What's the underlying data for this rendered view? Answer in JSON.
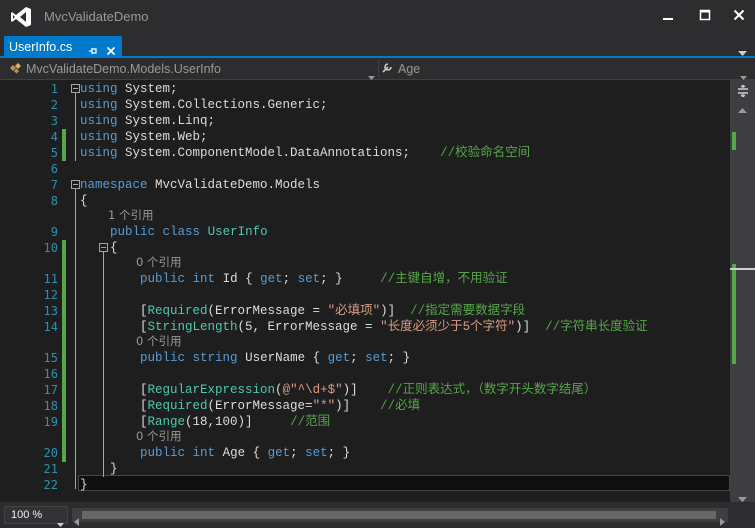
{
  "window": {
    "title": "MvcValidateDemo"
  },
  "tab": {
    "label": "UserInfo.cs"
  },
  "navbar": {
    "type_selector": "MvcValidateDemo.Models.UserInfo",
    "member_selector": "Age"
  },
  "editor": {
    "lines": [
      {
        "num": "1",
        "tokens": [
          [
            "kw",
            "using"
          ],
          [
            "",
            " System;"
          ]
        ]
      },
      {
        "num": "2",
        "tokens": [
          [
            "kw",
            "using"
          ],
          [
            "",
            " System.Collections.Generic;"
          ]
        ]
      },
      {
        "num": "3",
        "tokens": [
          [
            "kw",
            "using"
          ],
          [
            "",
            " System.Linq;"
          ]
        ]
      },
      {
        "num": "4",
        "tokens": [
          [
            "kw",
            "using"
          ],
          [
            "",
            " System.Web;"
          ]
        ]
      },
      {
        "num": "5",
        "tokens": [
          [
            "kw",
            "using"
          ],
          [
            "",
            " System.ComponentModel.DataAnnotations;    "
          ],
          [
            "cm",
            "//校验命名空间"
          ]
        ]
      },
      {
        "num": "6",
        "tokens": []
      },
      {
        "num": "7",
        "tokens": [
          [
            "kw",
            "namespace"
          ],
          [
            "",
            " MvcValidateDemo.Models"
          ]
        ]
      },
      {
        "num": "8",
        "tokens": [
          [
            "",
            "{"
          ]
        ]
      },
      {
        "num": "9",
        "tokens": [
          [
            "",
            "    "
          ],
          [
            "kw",
            "public"
          ],
          [
            "",
            " "
          ],
          [
            "kw",
            "class"
          ],
          [
            "",
            " "
          ],
          [
            "ty",
            "UserInfo"
          ]
        ]
      },
      {
        "num": "10",
        "tokens": [
          [
            "",
            "    {"
          ]
        ]
      },
      {
        "num": "11",
        "tokens": [
          [
            "",
            "        "
          ],
          [
            "kw",
            "public"
          ],
          [
            "",
            " "
          ],
          [
            "kw",
            "int"
          ],
          [
            "",
            " Id { "
          ],
          [
            "kw",
            "get"
          ],
          [
            "",
            "; "
          ],
          [
            "kw",
            "set"
          ],
          [
            "",
            "; }     "
          ],
          [
            "cm",
            "//主键自增，不用验证"
          ]
        ]
      },
      {
        "num": "12",
        "tokens": []
      },
      {
        "num": "13",
        "tokens": [
          [
            "",
            "        ["
          ],
          [
            "ty",
            "Required"
          ],
          [
            "",
            "(ErrorMessage = "
          ],
          [
            "st",
            "\"必填项\""
          ],
          [
            "",
            ")]  "
          ],
          [
            "cm",
            "//指定需要数据字段"
          ]
        ]
      },
      {
        "num": "14",
        "tokens": [
          [
            "",
            "        ["
          ],
          [
            "ty",
            "StringLength"
          ],
          [
            "",
            "(5, ErrorMessage = "
          ],
          [
            "st",
            "\"长度必须少于5个字符\""
          ],
          [
            "",
            ")]  "
          ],
          [
            "cm",
            "//字符串长度验证"
          ]
        ]
      },
      {
        "num": "15",
        "tokens": [
          [
            "",
            "        "
          ],
          [
            "kw",
            "public"
          ],
          [
            "",
            " "
          ],
          [
            "kw",
            "string"
          ],
          [
            "",
            " UserName { "
          ],
          [
            "kw",
            "get"
          ],
          [
            "",
            "; "
          ],
          [
            "kw",
            "set"
          ],
          [
            "",
            "; }"
          ]
        ]
      },
      {
        "num": "16",
        "tokens": []
      },
      {
        "num": "17",
        "tokens": [
          [
            "",
            "        ["
          ],
          [
            "ty",
            "RegularExpression"
          ],
          [
            "",
            "("
          ],
          [
            "st",
            "@\"^\\d+$\""
          ],
          [
            "",
            ")]    "
          ],
          [
            "cm",
            "//正则表达式，（数字开头数字结尾）"
          ]
        ]
      },
      {
        "num": "18",
        "tokens": [
          [
            "",
            "        ["
          ],
          [
            "ty",
            "Required"
          ],
          [
            "",
            "(ErrorMessage="
          ],
          [
            "st",
            "\"*\""
          ],
          [
            "",
            ")]    "
          ],
          [
            "cm",
            "//必填"
          ]
        ]
      },
      {
        "num": "19",
        "tokens": [
          [
            "",
            "        ["
          ],
          [
            "ty",
            "Range"
          ],
          [
            "",
            "(18,100)]     "
          ],
          [
            "cm",
            "//范围"
          ]
        ]
      },
      {
        "num": "20",
        "tokens": [
          [
            "",
            "        "
          ],
          [
            "kw",
            "public"
          ],
          [
            "",
            " "
          ],
          [
            "kw",
            "int"
          ],
          [
            "",
            " Age { "
          ],
          [
            "kw",
            "get"
          ],
          [
            "",
            "; "
          ],
          [
            "kw",
            "set"
          ],
          [
            "",
            "; }"
          ]
        ]
      },
      {
        "num": "21",
        "tokens": [
          [
            "",
            "    }"
          ]
        ]
      },
      {
        "num": "22",
        "tokens": [
          [
            "",
            "}"
          ]
        ]
      }
    ],
    "references": {
      "class_refs": "1 个引用",
      "id_refs": "0 个引用",
      "username_refs": "0 个引用",
      "age_refs": "0 个引用"
    }
  },
  "zoom": {
    "level": "100 %"
  },
  "colors": {
    "accent": "#007acc",
    "keyword": "#569cd6",
    "type": "#4ec9b0",
    "comment": "#57a64a",
    "string": "#d69d85",
    "line_number": "#2b91af"
  }
}
